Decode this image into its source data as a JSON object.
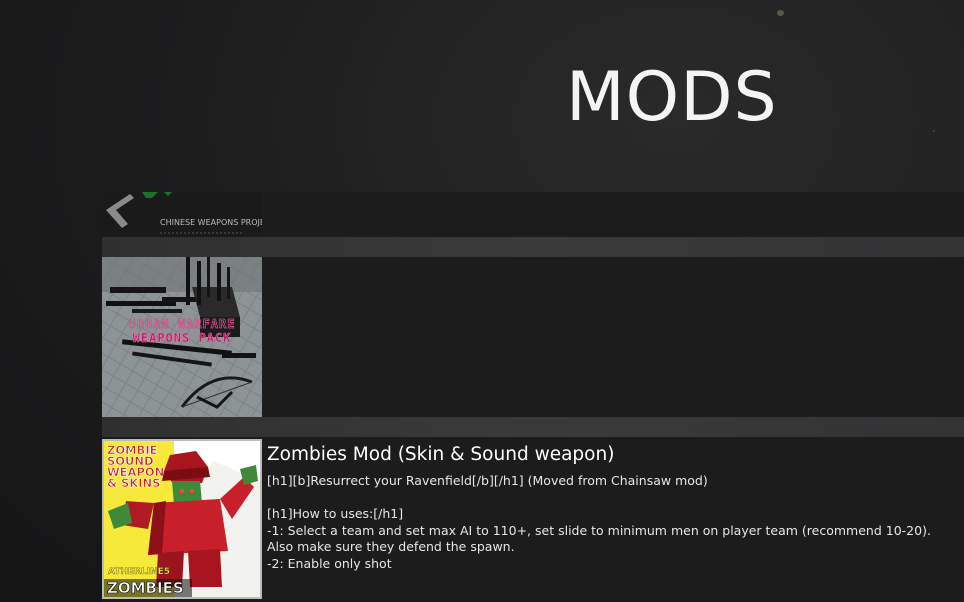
{
  "screen": {
    "title": "MODS"
  },
  "mods": [
    {
      "thumbnail_caption": "CHINESE WEAPONS PROJECT",
      "title": "",
      "description": []
    },
    {
      "thumbnail_caption_line1": "URBAN WARFARE",
      "thumbnail_caption_line2": "WEAPONS PACK",
      "title": "",
      "description": []
    },
    {
      "thumbnail_badge": [
        "ZOMBIE",
        "SOUND",
        "WEAPON",
        "& SKINS"
      ],
      "thumbnail_author": "ATHERLINE5",
      "thumbnail_label": "ZOMBIES",
      "title": "Zombies Mod (Skin & Sound weapon)",
      "description": [
        "[h1][b]Resurrect your Ravenfield[/b][/h1] (Moved from Chainsaw mod)",
        "",
        "[h1]How to uses:[/h1]",
        "-1: Select a team and set max AI to 110+, set slide to minimum men on player team (recommend 10-20).",
        "Also make sure they defend the spawn.",
        "-2: Enable only shot"
      ]
    }
  ],
  "colors": {
    "background": "#1e1e1f",
    "item_background": "#1c1c1d",
    "divider": "#353536",
    "zombie_thumb_yellow": "#f7e93a",
    "zombie_thumb_red": "#c8202a"
  }
}
